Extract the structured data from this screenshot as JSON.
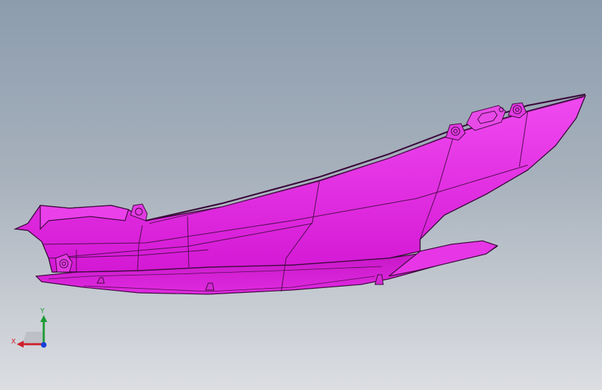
{
  "viewport": {
    "background_top": "#8c9cae",
    "background_bottom": "#dcdee2",
    "part_color": "#e61ee6",
    "edge_color": "#3a0a3a"
  },
  "triad": {
    "x_label": "X",
    "y_label": "Y",
    "x_color": "#d0202c",
    "y_color": "#1a9b32",
    "z_color": "#1a3fd8"
  }
}
